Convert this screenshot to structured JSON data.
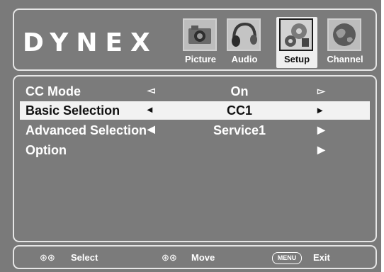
{
  "brand": {
    "logo_text": "DYNEX"
  },
  "tabs": [
    {
      "label": "Picture",
      "icon": "camera-icon",
      "active": false
    },
    {
      "label": "Audio",
      "icon": "headphones-icon",
      "active": false
    },
    {
      "label": "Setup",
      "icon": "gears-icon",
      "active": true
    },
    {
      "label": "Channel",
      "icon": "globe-icon",
      "active": false
    }
  ],
  "menu": [
    {
      "label": "CC Mode",
      "value": "On",
      "left_arrow": "◅",
      "right_arrow": "▻",
      "selected": false
    },
    {
      "label": "Basic Selection",
      "value": "CC1",
      "left_arrow": "◂",
      "right_arrow": "▸",
      "selected": true
    },
    {
      "label": "Advanced Selection",
      "value": "Service1",
      "left_arrow": "◀",
      "right_arrow": "▶",
      "selected": false
    },
    {
      "label": "Option",
      "value": "",
      "left_arrow": "",
      "right_arrow": "▶",
      "selected": false
    }
  ],
  "footer": {
    "select_icon": "⊛⊛",
    "select_label": "Select",
    "move_icon": "⊛⊛",
    "move_label": "Move",
    "menu_key": "MENU",
    "exit_label": "Exit"
  }
}
